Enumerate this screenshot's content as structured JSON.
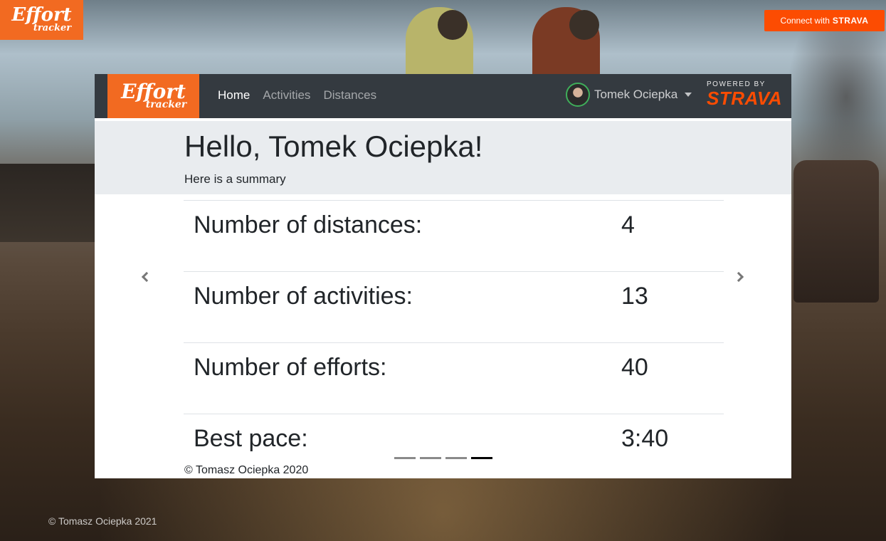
{
  "top_brand": {
    "line1": "Effort",
    "line2": "tracker"
  },
  "connect_button": {
    "prefix": "Connect with",
    "brand": "STRAVA"
  },
  "navbar": {
    "brand": {
      "line1": "Effort",
      "line2": "tracker"
    },
    "links": [
      {
        "label": "Home",
        "active": true
      },
      {
        "label": "Activities",
        "active": false
      },
      {
        "label": "Distances",
        "active": false
      }
    ],
    "user": {
      "name": "Tomek Ociepka"
    },
    "powered_by": {
      "label": "POWERED BY",
      "logo": "STRAVA"
    }
  },
  "jumbotron": {
    "title": "Hello, Tomek Ociepka!",
    "subtitle": "Here is a summary"
  },
  "stats": [
    {
      "label": "Number of distances:",
      "value": "4"
    },
    {
      "label": "Number of activities:",
      "value": "13"
    },
    {
      "label": "Number of efforts:",
      "value": "40"
    },
    {
      "label": "Best pace:",
      "value": "3:40"
    }
  ],
  "carousel": {
    "slide_count": 4,
    "active_index": 3
  },
  "card_footer": "© Tomasz Ociepka 2020",
  "page_footer": "© Tomasz Ociepka 2021",
  "colors": {
    "brand_orange": "#f26a21",
    "strava_orange": "#fc4c02",
    "navbar": "#343a40"
  }
}
